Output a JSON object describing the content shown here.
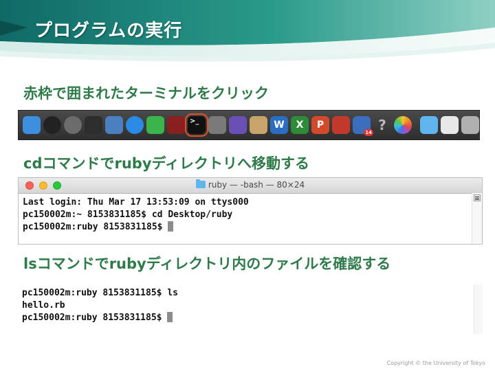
{
  "slide": {
    "title": "プログラムの実行",
    "heading1": "赤枠で囲まれたターミナルをクリック",
    "heading2": "cdコマンドでrubyディレクトリへ移動する",
    "heading3": "lsコマンドでrubyディレクトリ内のファイルを確認する",
    "copyright": "Copyright © the University of Tokyo"
  },
  "colors": {
    "heading": "#2f7a4a",
    "header_teal": "#1f7d74",
    "highlight": "#e0502a"
  },
  "dock": {
    "items": [
      {
        "name": "finder-icon",
        "bg": "#3d8fe0",
        "glyph": ""
      },
      {
        "name": "dashboard-icon",
        "bg": "#222222",
        "glyph": ""
      },
      {
        "name": "launchpad-icon",
        "bg": "#6c6c6c",
        "glyph": ""
      },
      {
        "name": "mission-control-icon",
        "bg": "#2d2d2d",
        "glyph": ""
      },
      {
        "name": "preview-icon",
        "bg": "#4a7fc0",
        "glyph": ""
      },
      {
        "name": "safari-icon",
        "bg": "#2b8ae6",
        "glyph": ""
      },
      {
        "name": "facetime-icon",
        "bg": "#3bb44a",
        "glyph": ""
      },
      {
        "name": "photo-booth-icon",
        "bg": "#8a1f1f",
        "glyph": ""
      },
      {
        "name": "terminal-icon",
        "bg": "#111111",
        "glyph": ">_"
      },
      {
        "name": "system-preferences-icon",
        "bg": "#7a7a7a",
        "glyph": ""
      },
      {
        "name": "emacs-icon",
        "bg": "#6a4fb5",
        "glyph": ""
      },
      {
        "name": "script-editor-icon",
        "bg": "#c9a46a",
        "glyph": ""
      },
      {
        "name": "word-icon",
        "bg": "#2b6dc2",
        "glyph": "W"
      },
      {
        "name": "excel-icon",
        "bg": "#2e8b3a",
        "glyph": "X"
      },
      {
        "name": "powerpoint-icon",
        "bg": "#d24a2a",
        "glyph": "P"
      },
      {
        "name": "sparkle-app-icon",
        "bg": "#c0392b",
        "glyph": ""
      },
      {
        "name": "calendar-app-icon",
        "bg": "#3a6fc0",
        "glyph": ""
      },
      {
        "name": "help-icon",
        "bg": "#3a3a3a",
        "glyph": "?"
      },
      {
        "name": "photos-icon",
        "bg": "#f2f2f2",
        "glyph": ""
      },
      {
        "name": "folder-icon",
        "bg": "#5fb5ee",
        "glyph": ""
      },
      {
        "name": "documents-icon",
        "bg": "#e8e8e8",
        "glyph": ""
      },
      {
        "name": "trash-icon",
        "bg": "#b0b0b0",
        "glyph": ""
      }
    ],
    "calendar_badge": "14"
  },
  "terminal1": {
    "window_title": "ruby — -bash — 80×24",
    "lines": [
      "Last login: Thu Mar 17 13:53:09 on ttys000",
      "pc150002m:~ 8153831185$ cd Desktop/ruby",
      "pc150002m:ruby 8153831185$ "
    ]
  },
  "terminal2": {
    "lines": [
      "pc150002m:ruby 8153831185$ ls",
      "hello.rb",
      "pc150002m:ruby 8153831185$ "
    ]
  }
}
